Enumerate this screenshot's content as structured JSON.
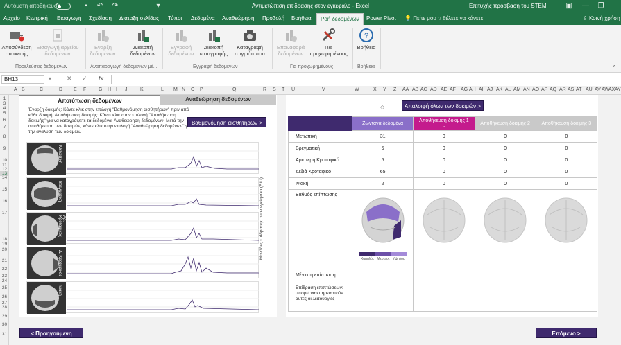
{
  "titlebar": {
    "autosave": "Αυτόματη αποθήκευση",
    "autosave_state": "Off",
    "doc_title": "Αντιμετώπιση επίδρασης στον εγκέφαλο - Excel",
    "user": "Επιτυχής πρόσβαση του STEM"
  },
  "tabs": [
    "Αρχείο",
    "Κεντρική",
    "Εισαγωγή",
    "Σχεδίαση",
    "Διάταξη σελίδας",
    "Τύποι",
    "Δεδομένα",
    "Αναθεώρηση",
    "Προβολή",
    "Βοήθεια",
    "Ροή δεδομένων",
    "Power Pivot"
  ],
  "tellme": "Πείτε μου τι θέλετε να κάνετε",
  "share": "Κοινή χρήση",
  "ribbon": {
    "b1": "Αποσύνδεση συσκευής",
    "b2": "Εισαγωγή αρχείου δεδομένων",
    "b3": "Έναρξη δεδομένων",
    "b4": "Διακοπή δεδομένων",
    "b5": "Εγγραφή δεδομένων",
    "b6": "Διακοπή καταγραφής",
    "b7": "Καταγραφή στιγμιότυπου",
    "b8": "Επαναφορά δεδομένων",
    "b9": "Για προχωρημένους",
    "b10": "Βοήθεια",
    "g1": "Προελεύσεις δεδομένων",
    "g2": "Αναπαραγωγή δεδομένων μέ...",
    "g3": "Εγγραφή δεδομένων",
    "g4": "Για προχωρημένους",
    "g5": "Βοήθεια"
  },
  "formula": {
    "namebox": "BH13",
    "fx": "fx",
    "value": ""
  },
  "columns": [
    "A",
    "B",
    "C",
    "D",
    "E",
    "F",
    "G",
    "H",
    "I",
    "J",
    "K",
    "L",
    "M",
    "N",
    "O",
    "P",
    "Q",
    "R",
    "S",
    "T",
    "U",
    "V",
    "W",
    "X",
    "Y",
    "Z",
    "AA",
    "AB",
    "AC",
    "AD",
    "AE",
    "AF",
    "AG",
    "AH",
    "AI",
    "AJ",
    "AK",
    "AL",
    "AM",
    "AN",
    "AO",
    "AP",
    "AQ",
    "AR",
    "AS",
    "AT",
    "AU",
    "AV",
    "AW",
    "AX",
    "AY",
    "AZ"
  ],
  "rows": [
    "1",
    "3",
    "4",
    "5",
    "6",
    "7",
    "8",
    "9",
    "10",
    "11",
    "12",
    "13",
    "14",
    "15",
    "16",
    "17",
    "18",
    "19",
    "20",
    "21",
    "22",
    "23",
    "24",
    "25",
    "26",
    "27",
    "28",
    "29",
    "30",
    "31"
  ],
  "panel": {
    "tab_left": "Αποτύπωση δεδομένων",
    "tab_right": "Αναθεώρηση δεδομένων",
    "instructions": "Έναρξη δοκιμής: Κάντε κλικ στην επιλογή \"Βαθμονόμηση αισθητήρων\" πριν από κάθε δοκιμή. Αποθήκευση δοκιμής: Κάντε κλικ στην επιλογή \"Αποθήκευση δοκιμής\" για να καταγράψετε τα δεδομένα. Αναθεώρηση δεδομένων: Μετά την αποθήκευση των δοκιμών, κάντε κλικ στην επιλογή \"Αναθεώρηση δεδομένων\" για την ανάλυση των δοκιμών.",
    "calibrate": "Βαθμονόμηση αισθητήρων >",
    "y_axis": "Μονάδες επίδρασης στον εγκέφαλο (BIU)",
    "sensors": [
      "Μετωπική",
      "Βρεγματική",
      "Αρ. Κροταφικός",
      "Δ. Κροταφικός",
      "Ινιακή"
    ]
  },
  "table": {
    "clear_all": "Απαλοιφή όλων των δοκιμών >",
    "headers": [
      "Ζωντανά δεδομένα",
      "Αποθήκευση δοκιμής 1",
      "Αποθήκευση δοκιμής 2",
      "Αποθήκευση δοκιμής 3"
    ],
    "rows": [
      {
        "label": "Μετωπική",
        "values": [
          "31",
          "0",
          "0",
          "0"
        ]
      },
      {
        "label": "Βρεγματική",
        "values": [
          "5",
          "0",
          "0",
          "0"
        ]
      },
      {
        "label": "Αριστερή Κροταφικό",
        "values": [
          "5",
          "0",
          "0",
          "0"
        ]
      },
      {
        "label": "Δεξιά Κροταφικό",
        "values": [
          "65",
          "0",
          "0",
          "0"
        ]
      },
      {
        "label": "Ινιακή",
        "values": [
          "2",
          "0",
          "0",
          "0"
        ]
      }
    ],
    "severity_label": "Βαθμός επίπτωσης",
    "legend": [
      "Χαμηλός",
      "Μεσαίος",
      "Υψηλός"
    ],
    "max_impact": "Μέγιστη επίπτωση",
    "function_label": "Επίδραση επιπτώσεων: μπορεί να επηρεαστούν αυτές οι λειτουργίες"
  },
  "nav": {
    "prev": "< Προηγούμενη",
    "next": "Επόμενο >"
  },
  "colors": {
    "excel_green": "#217346",
    "purple_dark": "#3f2a6e",
    "purple_live": "#8a6fc9",
    "magenta": "#c41b8d",
    "gray_header": "#c9c9c9"
  }
}
